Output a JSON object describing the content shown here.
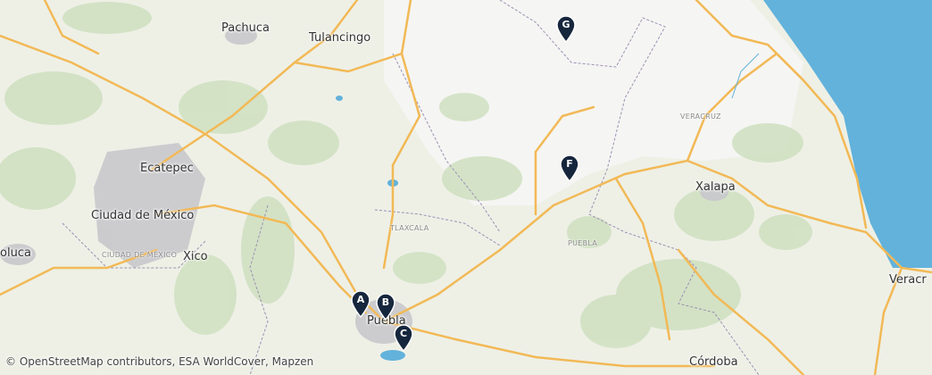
{
  "map": {
    "cities": [
      {
        "id": "pachuca",
        "label": "Pachuca"
      },
      {
        "id": "tulancingo",
        "label": "Tulancingo"
      },
      {
        "id": "ecatepec",
        "label": "Ecatepec"
      },
      {
        "id": "ciudad-de-mexico",
        "label": "Ciudad de México"
      },
      {
        "id": "toluca",
        "label": "oluca"
      },
      {
        "id": "xico",
        "label": "Xico"
      },
      {
        "id": "xalapa",
        "label": "Xalapa"
      },
      {
        "id": "veracruz-city",
        "label": "Veracr"
      },
      {
        "id": "puebla-city",
        "label": "Puebla"
      },
      {
        "id": "cordoba",
        "label": "Córdoba"
      }
    ],
    "regions": [
      {
        "id": "tlaxcala",
        "label": "TLAXCALA"
      },
      {
        "id": "puebla",
        "label": "PUEBLA"
      },
      {
        "id": "veracruz",
        "label": "VERACRUZ"
      },
      {
        "id": "ciudad-de-mexico-state",
        "label": "CIUDAD DE MÉXICO"
      }
    ],
    "markers": [
      {
        "id": "a",
        "label": "A"
      },
      {
        "id": "b",
        "label": "B"
      },
      {
        "id": "c",
        "label": "C"
      },
      {
        "id": "f",
        "label": "F"
      },
      {
        "id": "g",
        "label": "G"
      }
    ],
    "attribution": "© OpenStreetMap contributors, ESA WorldCover, Mapzen",
    "colors": {
      "land": "#eef0e6",
      "highland": "#f5f5f3",
      "forest": "#cfe0c0",
      "water": "#62b2db",
      "road": "#f2b956",
      "urban": "#c8c8cc",
      "border": "#9d8fb4",
      "marker": "#16263d"
    }
  }
}
